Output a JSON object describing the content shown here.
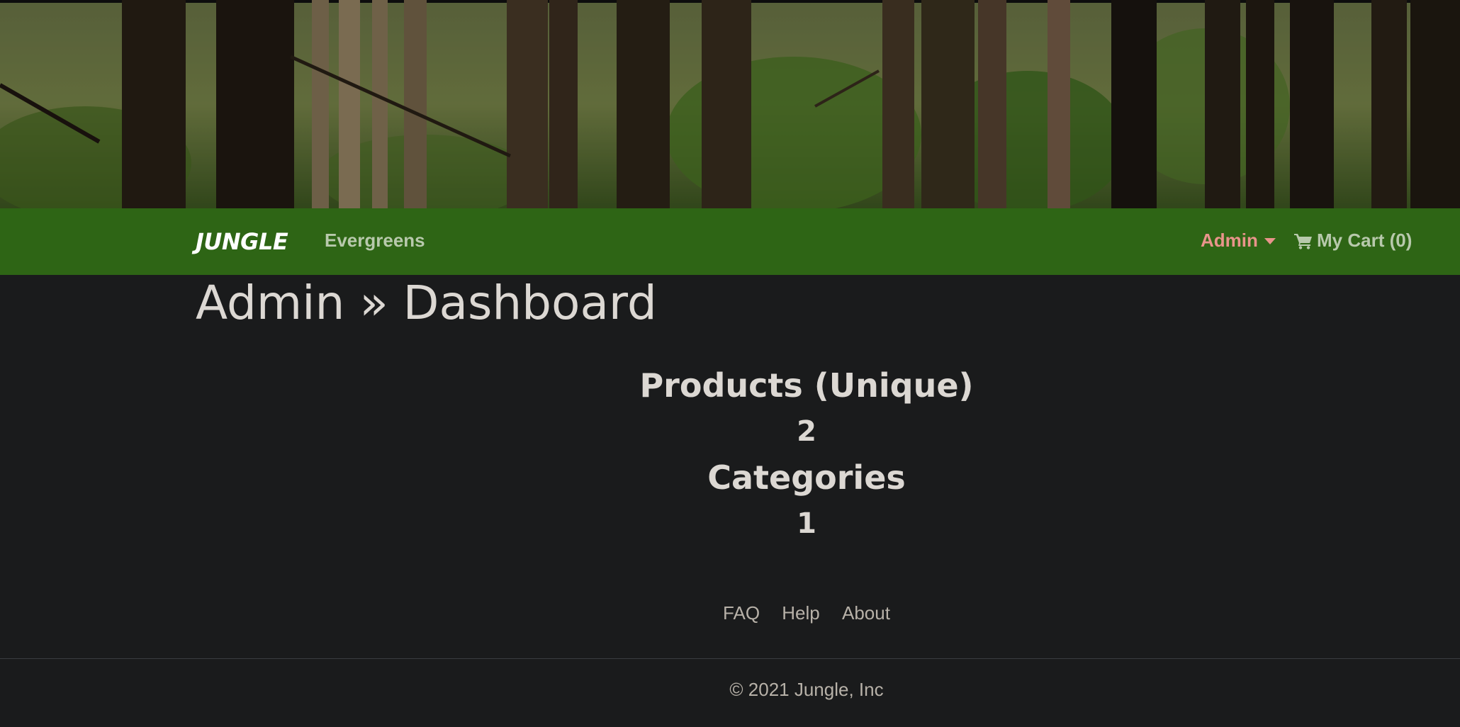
{
  "navbar": {
    "brand": "JUNGLE",
    "links": [
      "Evergreens"
    ],
    "admin_label": "Admin",
    "cart_label": "My Cart (0)"
  },
  "page": {
    "title": "Admin » Dashboard"
  },
  "stats": [
    {
      "label": "Products (Unique)",
      "value": "2"
    },
    {
      "label": "Categories",
      "value": "1"
    }
  ],
  "footer": {
    "links": [
      "FAQ",
      "Help",
      "About"
    ],
    "copyright": "© 2021 Jungle, Inc"
  },
  "colors": {
    "navbar_bg": "#2e6515",
    "page_bg": "#1a1b1c",
    "admin_accent": "#e9948b",
    "text_light": "#dcd8d3"
  }
}
